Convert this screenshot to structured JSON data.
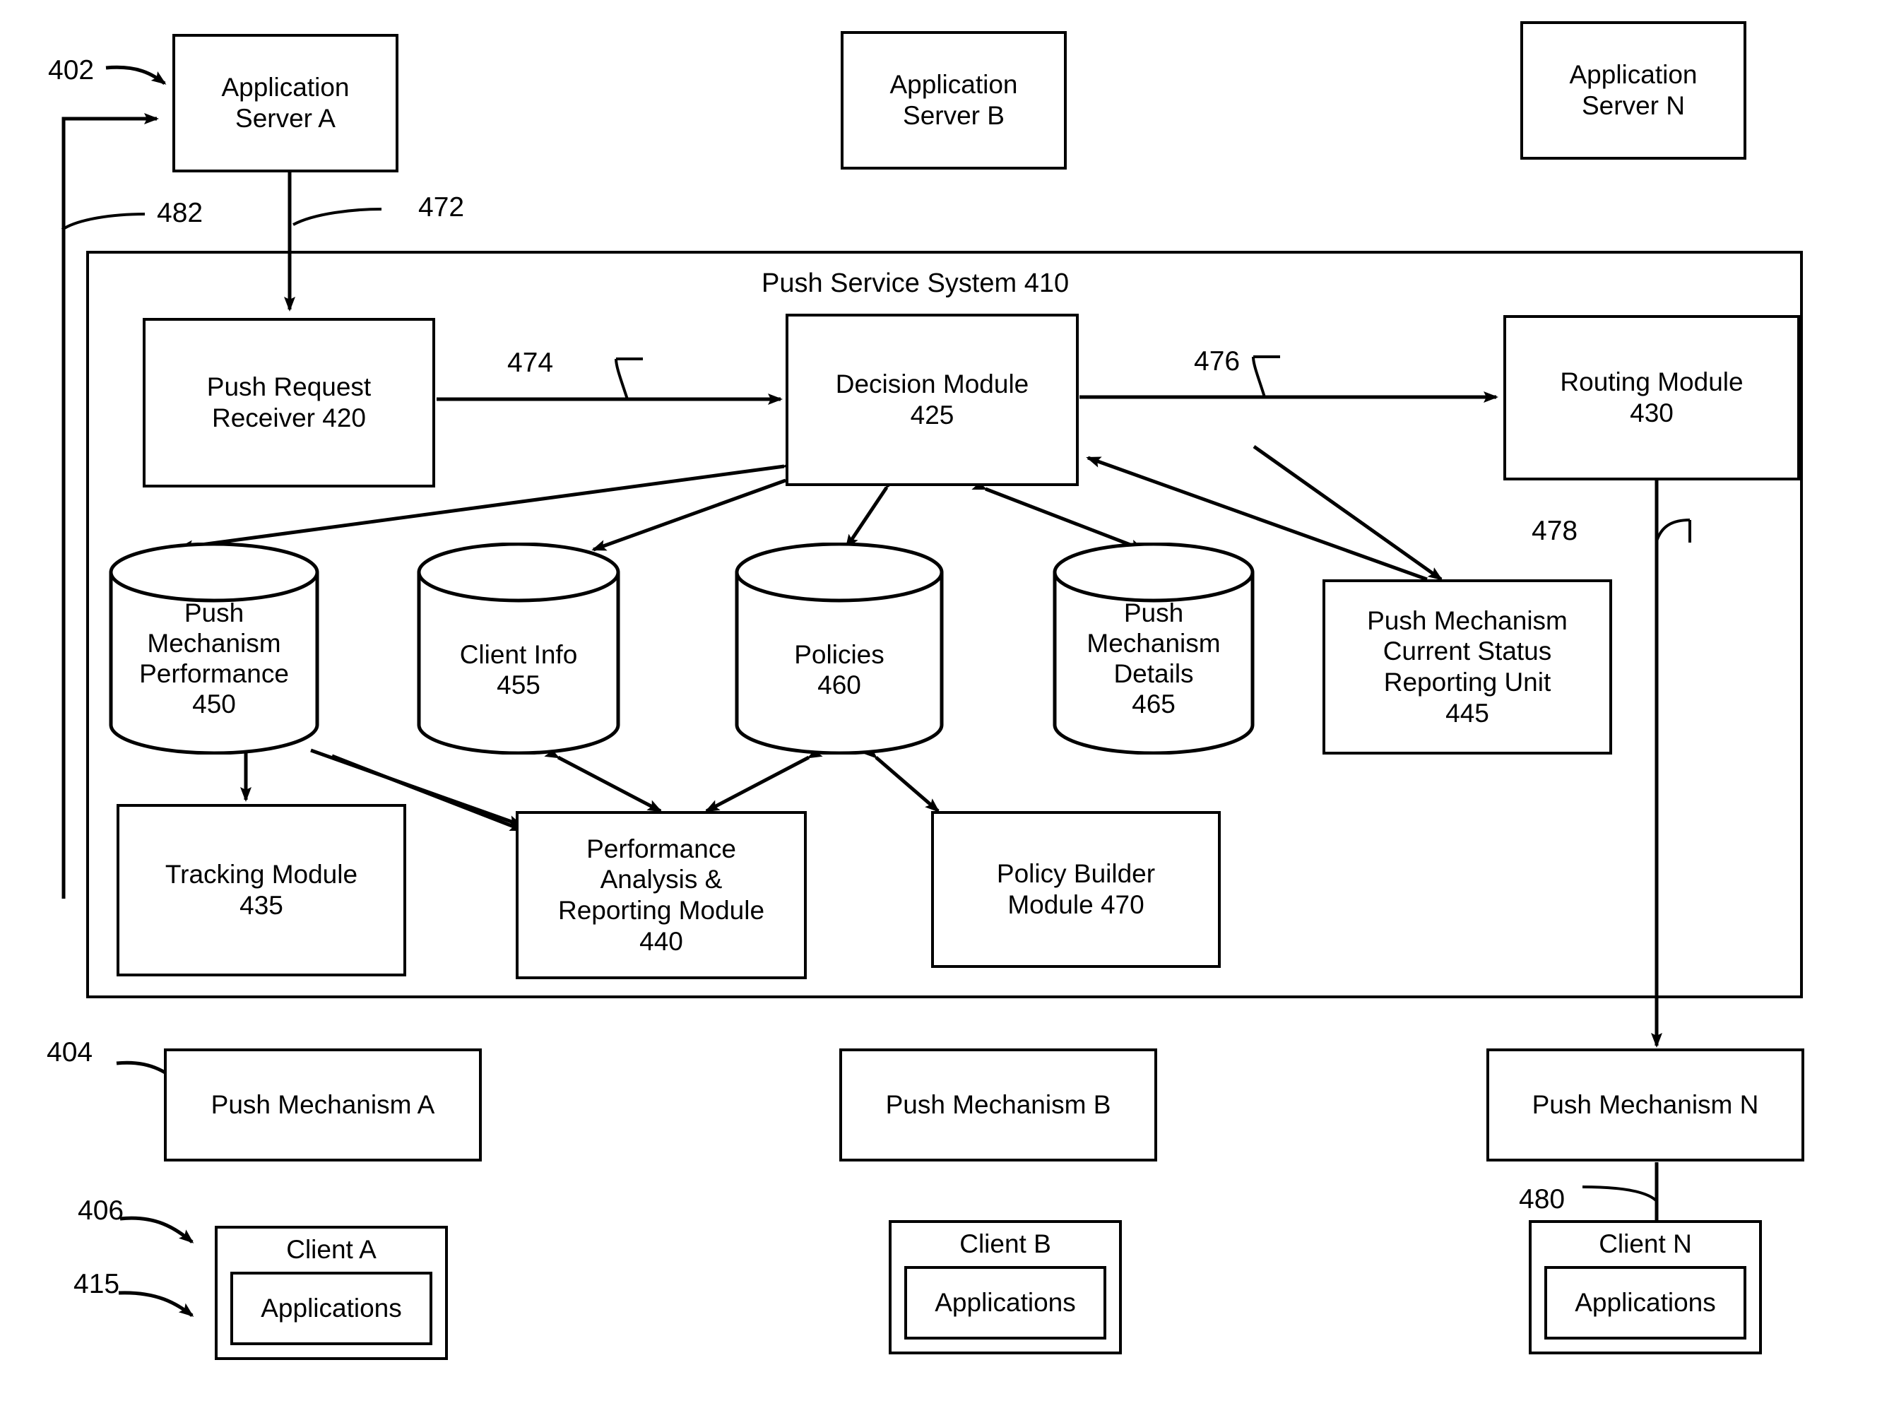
{
  "figure": {
    "servers": [
      {
        "id": "app-server-a",
        "label": "Application\nServer A"
      },
      {
        "id": "app-server-b",
        "label": "Application\nServer B"
      },
      {
        "id": "app-server-n",
        "label": "Application\nServer N"
      }
    ],
    "system": {
      "title": "Push Service System 410",
      "modules": [
        {
          "id": "push-request-receiver",
          "label": "Push Request\nReceiver 420"
        },
        {
          "id": "decision-module",
          "label": "Decision Module\n425"
        },
        {
          "id": "routing-module",
          "label": "Routing Module\n430"
        },
        {
          "id": "status-reporting-unit",
          "label": "Push Mechanism\nCurrent Status\nReporting Unit\n445"
        },
        {
          "id": "tracking-module",
          "label": "Tracking Module\n435"
        },
        {
          "id": "performance-analysis-module",
          "label": "Performance\nAnalysis &\nReporting Module\n440"
        },
        {
          "id": "policy-builder-module",
          "label": "Policy Builder\nModule 470"
        }
      ],
      "datastores": [
        {
          "id": "push-mechanism-performance",
          "label": "Push\nMechanism\nPerformance\n450"
        },
        {
          "id": "client-info",
          "label": "Client Info\n455"
        },
        {
          "id": "policies",
          "label": "Policies\n460"
        },
        {
          "id": "push-mechanism-details",
          "label": "Push\nMechanism\nDetails\n465"
        }
      ]
    },
    "push_mechanisms": [
      {
        "id": "push-mechanism-a",
        "label": "Push Mechanism A"
      },
      {
        "id": "push-mechanism-b",
        "label": "Push Mechanism B"
      },
      {
        "id": "push-mechanism-n",
        "label": "Push Mechanism N"
      }
    ],
    "clients": [
      {
        "id": "client-a",
        "label": "Client A",
        "inner": "Applications"
      },
      {
        "id": "client-b",
        "label": "Client B",
        "inner": "Applications"
      },
      {
        "id": "client-n",
        "label": "Client N",
        "inner": "Applications"
      }
    ],
    "reference_numerals": [
      {
        "id": "ref-402",
        "label": "402"
      },
      {
        "id": "ref-404",
        "label": "404"
      },
      {
        "id": "ref-406",
        "label": "406"
      },
      {
        "id": "ref-415",
        "label": "415"
      },
      {
        "id": "ref-472",
        "label": "472"
      },
      {
        "id": "ref-474",
        "label": "474"
      },
      {
        "id": "ref-476",
        "label": "476"
      },
      {
        "id": "ref-478",
        "label": "478"
      },
      {
        "id": "ref-480",
        "label": "480"
      },
      {
        "id": "ref-482",
        "label": "482"
      }
    ],
    "colors": {
      "ink": "#000000",
      "paper": "#ffffff"
    }
  }
}
